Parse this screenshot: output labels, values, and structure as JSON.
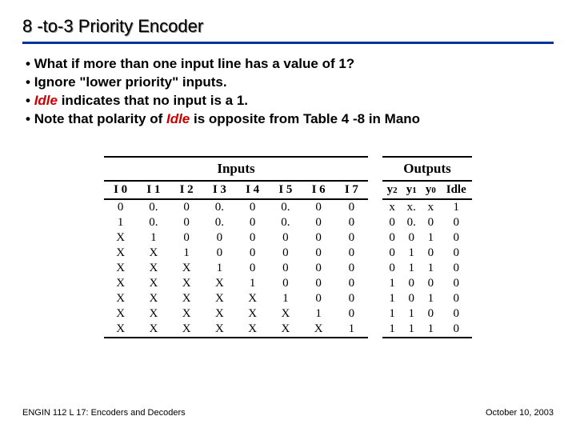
{
  "title": "8 -to-3  Priority Encoder",
  "bullets": [
    {
      "pre": "What if more than one input line has a value of  1?"
    },
    {
      "pre": "Ignore \"lower priority\" inputs."
    },
    {
      "emph": "Idle",
      "post": " indicates that no input is a 1."
    },
    {
      "pre": "Note that polarity of ",
      "emph": "Idle",
      "post": " is opposite from Table 4 -8 in Mano"
    }
  ],
  "inputs_label": "Inputs",
  "outputs_label": "Outputs",
  "input_cols": [
    "I 0",
    "I 1",
    "I 2",
    "I 3",
    "I 4",
    "I 5",
    "I 6",
    "I 7"
  ],
  "output_cols": [
    "y2",
    "y1",
    "y0",
    "Idle"
  ],
  "chart_data": {
    "type": "table",
    "title": "8-to-3 Priority Encoder truth table",
    "columns": [
      "I0",
      "I1",
      "I2",
      "I3",
      "I4",
      "I5",
      "I6",
      "I7",
      "y2",
      "y1",
      "y0",
      "Idle"
    ],
    "rows": [
      [
        "0",
        "0.",
        "0",
        "0.",
        "0",
        "0.",
        "0",
        "0",
        "x",
        "x.",
        "x",
        "1"
      ],
      [
        "1",
        "0.",
        "0",
        "0.",
        "0",
        "0.",
        "0",
        "0",
        "0",
        "0.",
        "0",
        "0"
      ],
      [
        "X",
        "1",
        "0",
        "0",
        "0",
        "0",
        "0",
        "0",
        "0",
        "0",
        "1",
        "0"
      ],
      [
        "X",
        "X",
        "1",
        "0",
        "0",
        "0",
        "0",
        "0",
        "0",
        "1",
        "0",
        "0"
      ],
      [
        "X",
        "X",
        "X",
        "1",
        "0",
        "0",
        "0",
        "0",
        "0",
        "1",
        "1",
        "0"
      ],
      [
        "X",
        "X",
        "X",
        "X",
        "1",
        "0",
        "0",
        "0",
        "1",
        "0",
        "0",
        "0"
      ],
      [
        "X",
        "X",
        "X",
        "X",
        "X",
        "1",
        "0",
        "0",
        "1",
        "0",
        "1",
        "0"
      ],
      [
        "X",
        "X",
        "X",
        "X",
        "X",
        "X",
        "1",
        "0",
        "1",
        "1",
        "0",
        "0"
      ],
      [
        "X",
        "X",
        "X",
        "X",
        "X",
        "X",
        "X",
        "1",
        "1",
        "1",
        "1",
        "0"
      ]
    ]
  },
  "footer_left": "ENGIN 112  L 17: Encoders and Decoders",
  "footer_right": "October 10, 2003"
}
